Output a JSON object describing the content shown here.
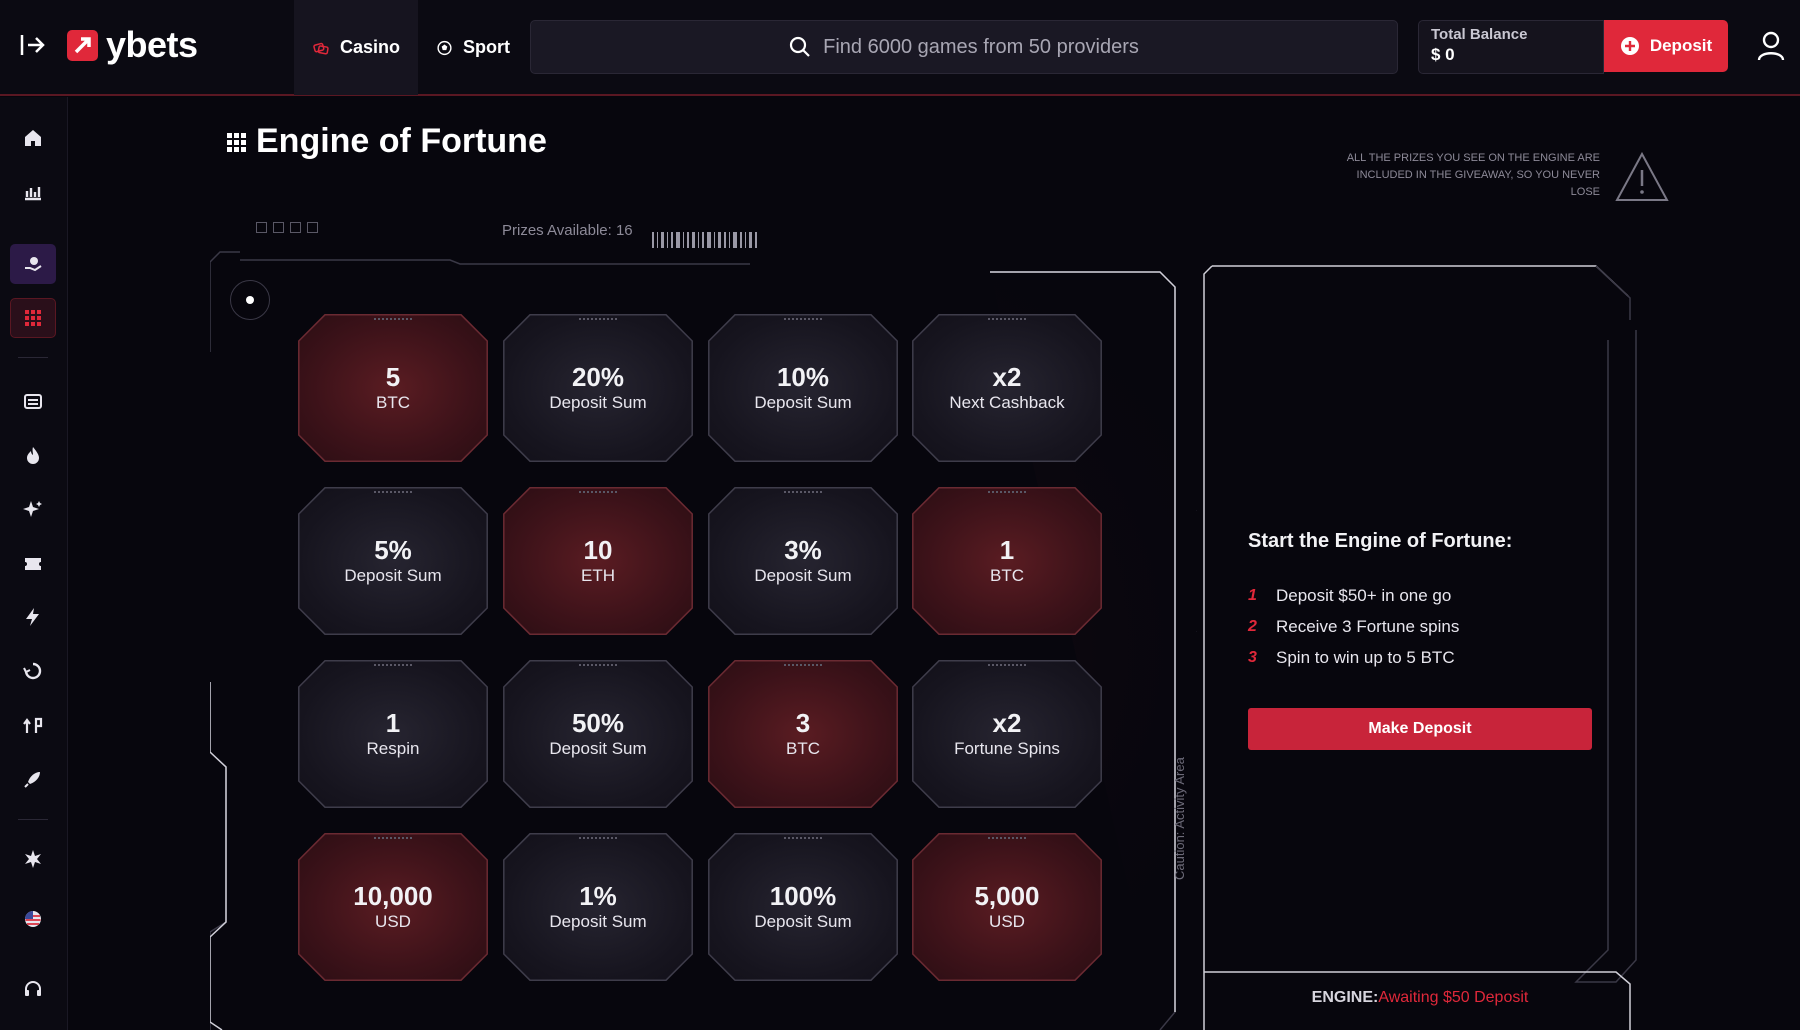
{
  "header": {
    "logo_text": "ybets",
    "tabs": [
      {
        "label": "Casino",
        "icon": "casino-chips-icon"
      },
      {
        "label": "Sport",
        "icon": "soccer-ball-icon"
      }
    ],
    "search_placeholder": "Find 6000 games from 50 providers",
    "balance_label": "Total Balance",
    "balance_value": "$ 0",
    "deposit_label": "Deposit",
    "accent": "#e0283a"
  },
  "sidebar": {
    "items": [
      {
        "icon": "home-icon"
      },
      {
        "icon": "stats-chart-icon"
      },
      {
        "icon": "bonus-hand-icon"
      },
      {
        "icon": "grid-apps-icon"
      },
      {
        "icon": "slot-machine-icon"
      },
      {
        "icon": "fire-icon"
      },
      {
        "icon": "sparkle-icon"
      },
      {
        "icon": "ticket-icon"
      },
      {
        "icon": "lightning-icon"
      },
      {
        "icon": "spin-icon"
      },
      {
        "icon": "promo-icon"
      },
      {
        "icon": "rocket-icon"
      },
      {
        "icon": "star-burst-icon"
      },
      {
        "icon": "us-flag-icon"
      },
      {
        "icon": "support-headset-icon"
      }
    ]
  },
  "page": {
    "title": "Engine of Fortune",
    "notice": "ALL THE PRIZES YOU SEE ON THE ENGINE ARE INCLUDED IN THE GIVEAWAY, SO YOU NEVER LOSE",
    "prizes_available": "Prizes Available: 16",
    "caution_label": "Caution: Activity Area"
  },
  "prizes": [
    {
      "big": "5",
      "small": "BTC",
      "style": "red"
    },
    {
      "big": "20%",
      "small": "Deposit Sum",
      "style": "dark"
    },
    {
      "big": "10%",
      "small": "Deposit Sum",
      "style": "dark"
    },
    {
      "big": "x2",
      "small": "Next Cashback",
      "style": "dark"
    },
    {
      "big": "5%",
      "small": "Deposit Sum",
      "style": "dark"
    },
    {
      "big": "10",
      "small": "ETH",
      "style": "red"
    },
    {
      "big": "3%",
      "small": "Deposit Sum",
      "style": "dark"
    },
    {
      "big": "1",
      "small": "BTC",
      "style": "red"
    },
    {
      "big": "1",
      "small": "Respin",
      "style": "dark"
    },
    {
      "big": "50%",
      "small": "Deposit Sum",
      "style": "dark"
    },
    {
      "big": "3",
      "small": "BTC",
      "style": "red"
    },
    {
      "big": "x2",
      "small": "Fortune Spins",
      "style": "dark"
    },
    {
      "big": "10,000",
      "small": "USD",
      "style": "red"
    },
    {
      "big": "1%",
      "small": "Deposit Sum",
      "style": "dark"
    },
    {
      "big": "100%",
      "small": "Deposit Sum",
      "style": "dark"
    },
    {
      "big": "5,000",
      "small": "USD",
      "style": "red"
    }
  ],
  "panel": {
    "title": "Start the Engine of Fortune:",
    "steps": [
      {
        "num": "1",
        "text": "Deposit $50+ in one go"
      },
      {
        "num": "2",
        "text": "Receive 3 Fortune spins"
      },
      {
        "num": "3",
        "text": "Spin to win up to 5 BTC"
      }
    ],
    "cta": "Make Deposit",
    "status_label": "ENGINE:",
    "status_value": "Awaiting $50 Deposit"
  }
}
